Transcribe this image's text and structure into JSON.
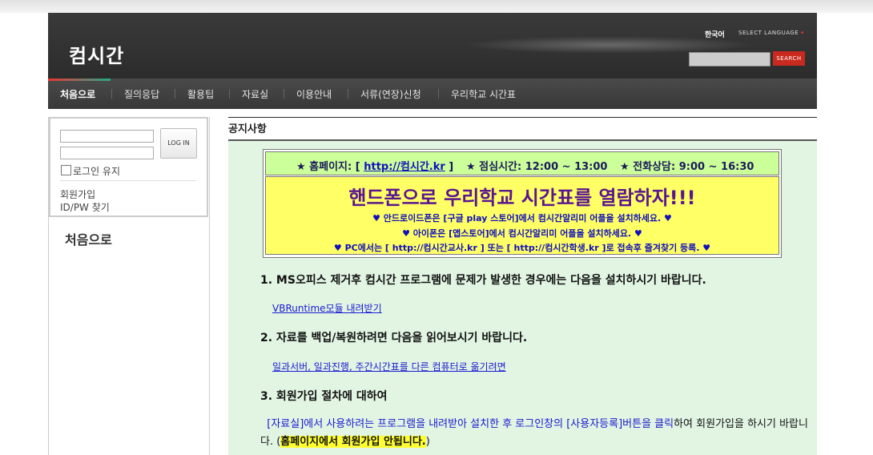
{
  "header": {
    "site_title": "컴시간",
    "lang_current": "한국어",
    "lang_select": "SELECT LANGUAGE",
    "search_button": "SEARCH"
  },
  "nav": {
    "items": [
      "처음으로",
      "질의응답",
      "활용팁",
      "자료실",
      "이용안내",
      "서류(연장)신청",
      "우리학교 시간표"
    ]
  },
  "login": {
    "button": "LOG IN",
    "keep_login": "로그인 유지",
    "signup": "회원가입",
    "find": "ID/PW 찾기"
  },
  "sidebar": {
    "home": "처음으로"
  },
  "content": {
    "title": "공지사항",
    "info": {
      "homepage_prefix": "★ 홈페이지: [ ",
      "homepage_link": "http://컴시간.kr",
      "homepage_suffix": " ]",
      "hours": "★ 점심시간: 12:00 ~ 13:00",
      "phone": "★ 전화상담: 9:00 ~ 16:30"
    },
    "headline": "핸드폰으로 우리학교 시간표를 열람하자!!!",
    "android": "♥ 안드로이드폰은 [구글 play 스토어]에서 컴시간알리미 어플을 설치하세요. ♥",
    "iphone": "♥ 아이폰은 [앱스토어]에서 컴시간알리미 어플을 설치하세요. ♥",
    "pc": "♥ PC에서는 [ http://컴시간교사.kr ] 또는 [ http://컴시간학생.kr ]로 접속후 즐겨찾기 등록. ♥",
    "section1": "1. MS오피스 제거후 컴시간 프로그램에 문제가 발생한 경우에는 다음을 설치하시기 바랍니다.",
    "section1_link": "VBRuntime모듈 내려받기",
    "section2": "2. 자료를 백업/복원하려면 다음을 읽어보시기 바랍니다.",
    "section2_link": "일과서버, 일과진행, 주간시간표를 다른 컴퓨터로 옮기려면",
    "section3": "3. 회원가입 절차에 대하여",
    "para_blue": "[자료실]에서 사용하려는 프로그램을 내려받아 설치한 후 로그인창의 [사용자등록]버튼을 클릭",
    "para_rest": "하여 회원가입을 하시기 바랍니다. (",
    "para_highlight": "홈페이지에서 회원가입 안됩니다.",
    "para_end": ")"
  }
}
